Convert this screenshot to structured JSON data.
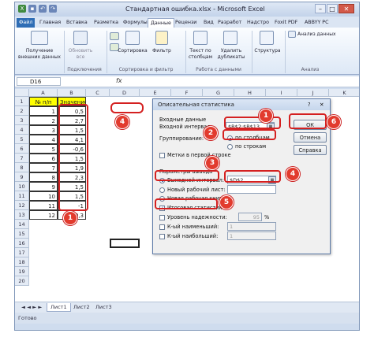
{
  "window": {
    "title": "Стандартная ошибка.xlsx - Microsoft Excel"
  },
  "tabs": [
    "Файл",
    "Главная",
    "Вставка",
    "Разметка",
    "Формулы",
    "Данные",
    "Рецензи",
    "Вид",
    "Разработ",
    "Надстро",
    "Foxit PDF",
    "ABBYY PC"
  ],
  "ribbon": {
    "get_external": "Получение внешних данных",
    "refresh_all": "Обновить все",
    "sort": "Сортировка",
    "filter": "Фильтр",
    "text_to_cols": "Текст по столбцам",
    "remove_dup": "Удалить дубликаты",
    "structure": "Структура",
    "analysis": "Анализ данных",
    "groups": {
      "connections": "Подключения",
      "sort_filter": "Сортировка и фильтр",
      "data_tools": "Работа с данными",
      "analysis": "Анализ"
    }
  },
  "formula_bar": {
    "name_box": "D16",
    "fx": "fx"
  },
  "columns": [
    "A",
    "B",
    "C",
    "D",
    "E",
    "F",
    "G",
    "H",
    "I",
    "J",
    "K"
  ],
  "rows": [
    "1",
    "2",
    "3",
    "4",
    "5",
    "6",
    "7",
    "8",
    "9",
    "10",
    "11",
    "12",
    "13",
    "14",
    "15",
    "16",
    "17",
    "18",
    "19",
    "20"
  ],
  "table": {
    "header": [
      "№ п/п",
      "Значение"
    ],
    "rows": [
      [
        "1",
        "0,5"
      ],
      [
        "2",
        "2,7"
      ],
      [
        "3",
        "1,5"
      ],
      [
        "4",
        "4,1"
      ],
      [
        "5",
        "-0,6"
      ],
      [
        "6",
        "1,5"
      ],
      [
        "7",
        "1,9"
      ],
      [
        "8",
        "2,3"
      ],
      [
        "9",
        "1,5"
      ],
      [
        "10",
        "1,5"
      ],
      [
        "11",
        "-1"
      ],
      [
        "12",
        "-0,3"
      ]
    ]
  },
  "sheets": [
    "Лист1",
    "Лист2",
    "Лист3"
  ],
  "status": "Готово",
  "dialog": {
    "title": "Описательная статистика",
    "input_section": "Входные данные",
    "input_range_label": "Входной интервал:",
    "input_range_value": "$B$2:$B$13",
    "grouping_label": "Группирование:",
    "by_columns": "по столбцам",
    "by_rows": "по строкам",
    "labels_first_row": "Метки в первой строке",
    "output_section": "Параметры вывода",
    "output_range_label": "Выходной интервал:",
    "output_range_value": "$D$2",
    "new_sheet": "Новый рабочий лист:",
    "new_book": "Новая рабочая книга",
    "summary": "Итоговая статистика",
    "confidence": "Уровень надежности:",
    "confidence_value": "95",
    "percent": "%",
    "kth_smallest": "К-ый наименьший:",
    "kth_largest": "К-ый наибольший:",
    "kth_value": "1",
    "ok": "ОК",
    "cancel": "Отмена",
    "help": "Справка"
  },
  "badges": [
    "1",
    "2",
    "3",
    "4",
    "5",
    "6",
    "1",
    "4"
  ],
  "colors": {
    "badge": "#e23b2e",
    "highlight": "#ffff00",
    "accent": "#2e6db5"
  }
}
